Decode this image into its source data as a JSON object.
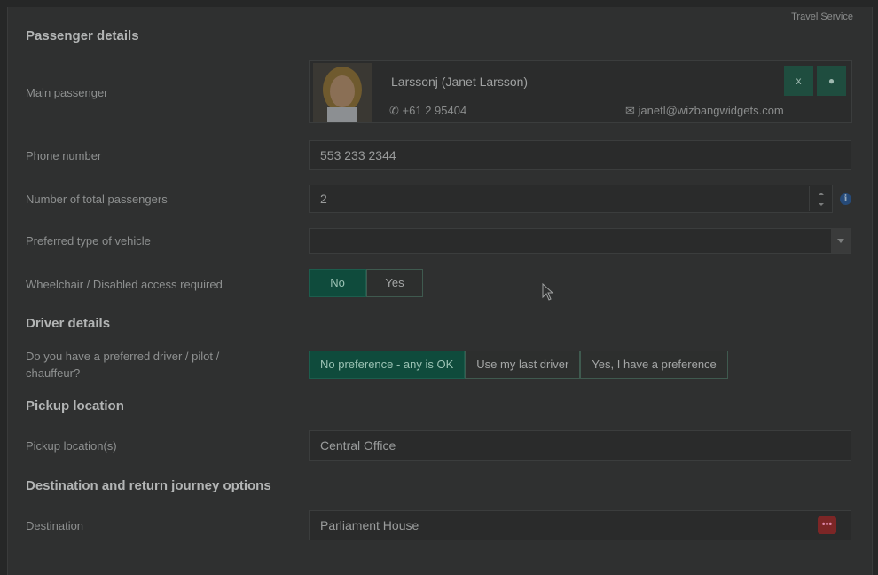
{
  "header": {
    "service_label": "Travel Service"
  },
  "sections": {
    "passenger": "Passenger details",
    "driver": "Driver details",
    "pickup": "Pickup location",
    "destination": "Destination and return journey options"
  },
  "main_passenger": {
    "label": "Main passenger",
    "name": "Larssonj (Janet Larsson)",
    "phone": "+61 2 95404",
    "email": "janetl@wizbangwidgets.com",
    "remove_label": "x"
  },
  "phone_number": {
    "label": "Phone number",
    "value": "553 233 2344"
  },
  "total_passengers": {
    "label": "Number of total passengers",
    "value": "2"
  },
  "vehicle_type": {
    "label": "Preferred type of vehicle",
    "value": ""
  },
  "wheelchair": {
    "label": "Wheelchair / Disabled access required",
    "options": [
      "No",
      "Yes"
    ],
    "selected": "No"
  },
  "preferred_driver": {
    "label_line1": "Do you have a preferred driver / pilot /",
    "label_line2": "chauffeur?",
    "options": [
      "No preference - any is OK",
      "Use my last driver",
      "Yes, I have a preference"
    ],
    "selected": "No preference - any is OK"
  },
  "pickup_location": {
    "label": "Pickup location(s)",
    "value": "Central Office"
  },
  "destination_field": {
    "label": "Destination",
    "value": "Parliament House"
  },
  "colors": {
    "accent": "#0f4b3c",
    "overlay": "#2f3030",
    "alert": "#7c2626"
  }
}
